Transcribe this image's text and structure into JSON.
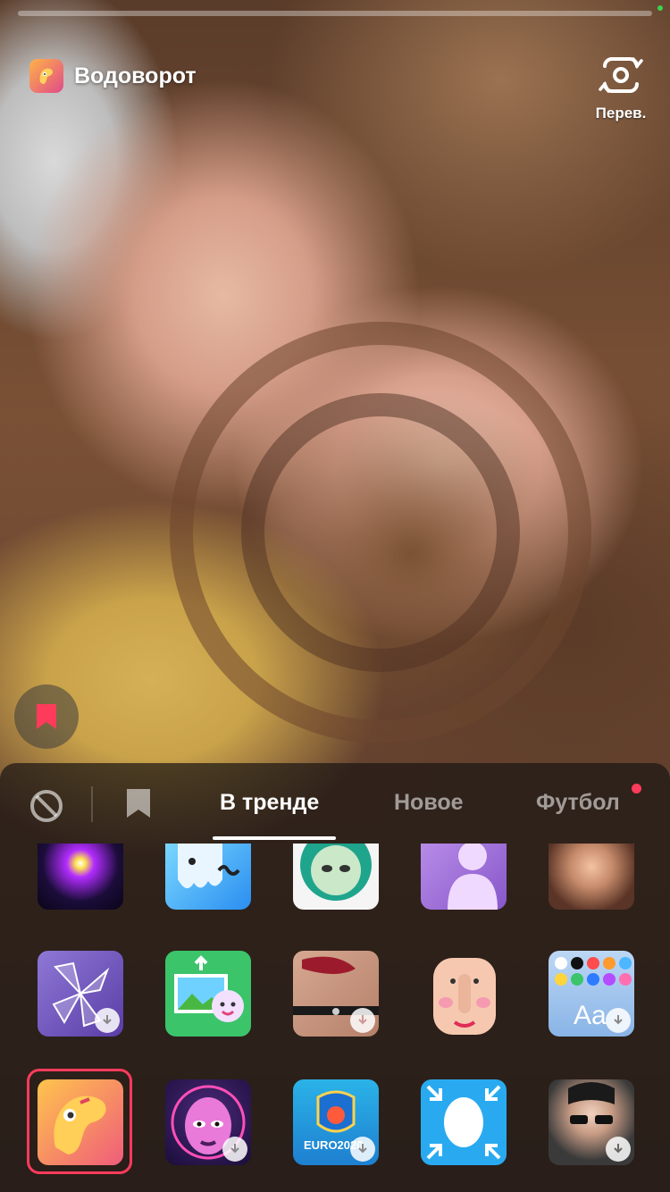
{
  "effect": {
    "name": "Водоворот"
  },
  "flip": {
    "label": "Перев."
  },
  "tabs": [
    {
      "label": "В тренде"
    },
    {
      "label": "Новое"
    },
    {
      "label": "Футбол"
    }
  ],
  "colors": {
    "accent": "#ff3b5c",
    "panel": "#1c1614",
    "active_tab": "#ffffff"
  },
  "grid": {
    "rows": [
      [
        "sparkle-effect-icon",
        "ghost-effect-icon",
        "alien-face-effect-icon",
        "figure-effect-icon",
        "portrait-effect-icon"
      ],
      [
        "shatter-effect-icon",
        "photo-sticker-effect-icon",
        "lips-choker-effect-icon",
        "face-distort-effect-icon",
        "color-text-effect-icon"
      ],
      [
        "whirlpool-effect-icon",
        "purple-face-effect-icon",
        "euro2020-effect-icon",
        "shrink-face-effect-icon",
        "sunglasses-portrait-effect-icon"
      ]
    ],
    "selected": "whirlpool-effect-icon"
  },
  "tile_texts": {
    "euro": "EURO2020",
    "aa": "Aa"
  }
}
